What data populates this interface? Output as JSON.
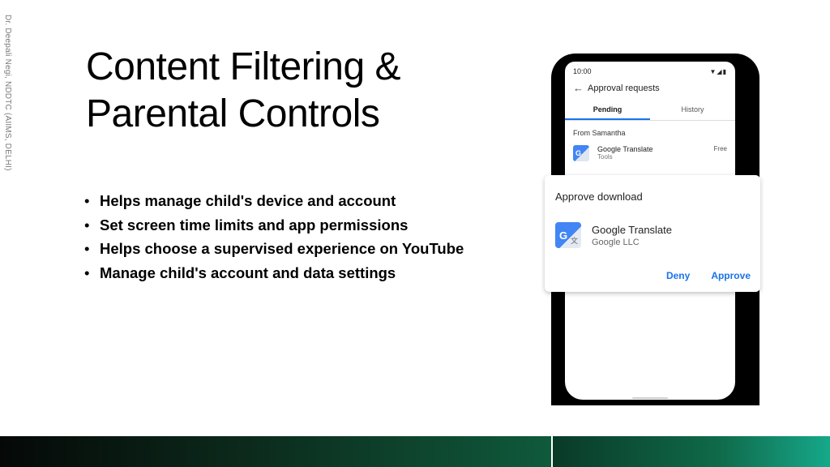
{
  "slide": {
    "side_credit": "Dr. Deepali Negi, NDDTC (AIIMS, DELHI)",
    "title_line1": "Content Filtering &",
    "title_line2": "Parental Controls",
    "bullets": [
      "Helps manage child's device and account",
      "Set screen time limits and app permissions",
      "Helps choose a supervised experience on YouTube",
      "Manage child's account and data settings"
    ]
  },
  "phone": {
    "time": "10:00",
    "status_icons": "▼◢▮",
    "appbar_title": "Approval requests",
    "tabs": [
      "Pending",
      "History"
    ],
    "from_label": "From Samantha",
    "request": {
      "app": "Google Translate",
      "category": "Tools",
      "price": "Free"
    }
  },
  "dialog": {
    "title": "Approve download",
    "app_name": "Google Translate",
    "developer": "Google LLC",
    "deny_label": "Deny",
    "approve_label": "Approve"
  },
  "colors": {
    "accent": "#1a73e8",
    "footer_dark": "#050807",
    "footer_green": "#16a88a"
  }
}
